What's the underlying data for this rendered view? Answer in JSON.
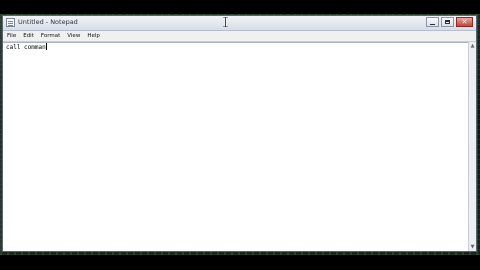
{
  "window": {
    "title": "Untitled - Notepad",
    "controls": {
      "minimize": "minimize",
      "maximize": "maximize",
      "close": "close"
    }
  },
  "menu": {
    "items": [
      "File",
      "Edit",
      "Format",
      "View",
      "Help"
    ]
  },
  "editor": {
    "text": "call comman"
  },
  "icons": {
    "app": "notepad-icon",
    "cursor": "text-cursor-icon",
    "scroll_up": "scroll-up-arrow-icon",
    "scroll_down": "scroll-down-arrow-icon"
  },
  "colors": {
    "close_button": "#c4453a",
    "titlebar": "#d7dee7"
  }
}
